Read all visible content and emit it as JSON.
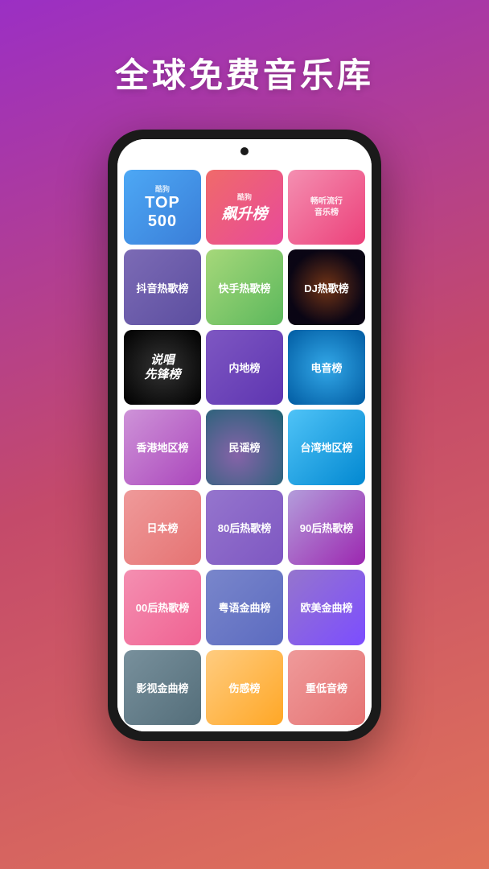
{
  "headline": "全球免费音乐库",
  "grid_items": [
    {
      "id": "top500",
      "label": "TOP 500",
      "sub": "酷狗",
      "type": "top500"
    },
    {
      "id": "piaosheng",
      "label": "飙升榜",
      "sub": "酷狗",
      "type": "piaosheng"
    },
    {
      "id": "liuxing",
      "label": "畅听流行音乐榜",
      "sub": "",
      "type": "liuxing"
    },
    {
      "id": "douyin",
      "label": "抖音热歌榜",
      "type": "douyin"
    },
    {
      "id": "kuaishou",
      "label": "快手热歌榜",
      "type": "kuaishou"
    },
    {
      "id": "dj",
      "label": "DJ热歌榜",
      "type": "dj"
    },
    {
      "id": "shuochang",
      "label": "说唱先锋榜",
      "type": "shuochang"
    },
    {
      "id": "neidi",
      "label": "内地榜",
      "type": "neidi"
    },
    {
      "id": "dianyin",
      "label": "电音榜",
      "type": "dianyin"
    },
    {
      "id": "xianggang",
      "label": "香港地区榜",
      "type": "xianggang"
    },
    {
      "id": "minyao",
      "label": "民谣榜",
      "type": "minyao"
    },
    {
      "id": "taiwan",
      "label": "台湾地区榜",
      "type": "taiwan"
    },
    {
      "id": "riben",
      "label": "日本榜",
      "type": "riben"
    },
    {
      "id": "80hou",
      "label": "80后热歌榜",
      "type": "80hou"
    },
    {
      "id": "90hou",
      "label": "90后热歌榜",
      "type": "90hou"
    },
    {
      "id": "00hou",
      "label": "00后热歌榜",
      "type": "00hou"
    },
    {
      "id": "yueyu",
      "label": "粤语金曲榜",
      "type": "yueyu"
    },
    {
      "id": "oumei",
      "label": "欧美金曲榜",
      "type": "oumei"
    },
    {
      "id": "yingshi",
      "label": "影视金曲榜",
      "type": "yingshi"
    },
    {
      "id": "shangan",
      "label": "伤感榜",
      "type": "shangan"
    },
    {
      "id": "zhongdi",
      "label": "重低音榜",
      "type": "zhongdi"
    }
  ]
}
